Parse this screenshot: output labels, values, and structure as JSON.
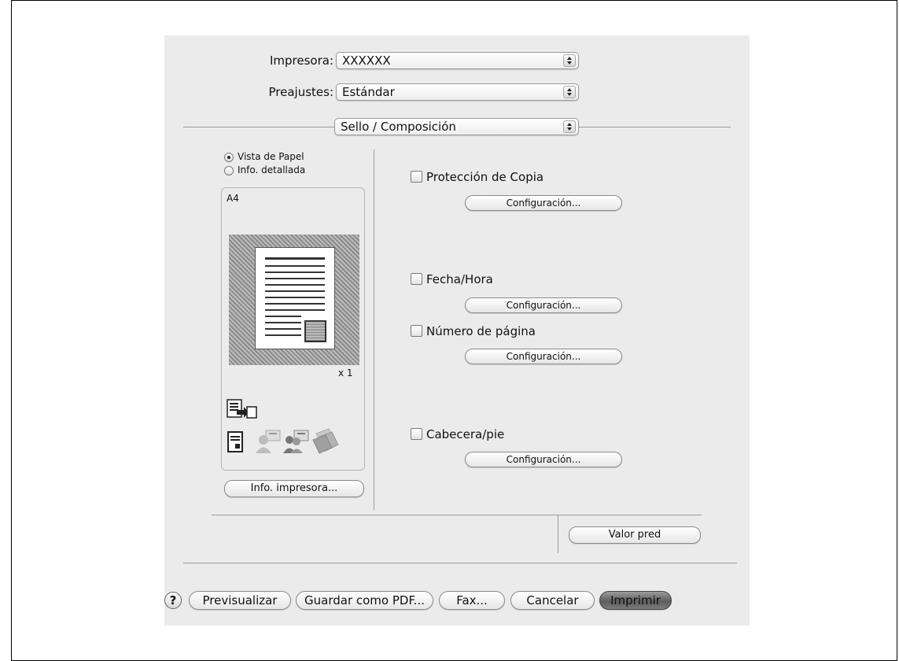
{
  "printer": {
    "label": "Impresora:",
    "value": "XXXXXX"
  },
  "presets": {
    "label": "Preajustes:",
    "value": "Estándar"
  },
  "panel_selector": {
    "value": "Sello / Composición"
  },
  "preview": {
    "radio_options": [
      {
        "label": "Vista de Papel",
        "selected": true
      },
      {
        "label": "Info. detallada",
        "selected": false
      }
    ],
    "paper_size": "A4",
    "copies": "x 1",
    "printer_info_button": "Info. impresora..."
  },
  "options": [
    {
      "label": "Protección de Copia",
      "checked": false,
      "button": "Configuración..."
    },
    {
      "label": "Fecha/Hora",
      "checked": false,
      "button": "Configuración..."
    },
    {
      "label": "Número de página",
      "checked": false,
      "button": "Configuración..."
    },
    {
      "label": "Cabecera/pie",
      "checked": false,
      "button": "Configuración..."
    }
  ],
  "default_button": "Valor pred",
  "footer": {
    "help": "?",
    "preview": "Previsualizar",
    "save_pdf": "Guardar como PDF...",
    "fax": "Fax...",
    "cancel": "Cancelar",
    "print": "Imprimir"
  }
}
